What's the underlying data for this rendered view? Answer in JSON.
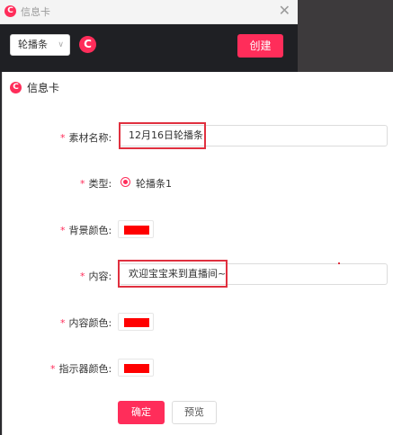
{
  "back_window": {
    "logo_glyph": "C",
    "title": "信息卡",
    "close_glyph": "✕",
    "toolbar": {
      "dropdown_value": "轮播条",
      "dropdown_chevron": "∨",
      "refresh_glyph": "C",
      "create_label": "创建"
    }
  },
  "dialog": {
    "logo_glyph": "C",
    "title": "信息卡",
    "form": {
      "material_name": {
        "label": "素材名称:",
        "value": "12月16日轮播条"
      },
      "type": {
        "label": "类型:",
        "option": "轮播条1",
        "selected": true
      },
      "bg_color": {
        "label": "背景颜色:",
        "color": "#ff0000"
      },
      "content": {
        "label": "内容:",
        "value": "欢迎宝宝来到直播间~"
      },
      "content_color": {
        "label": "内容颜色:",
        "color": "#ff0000"
      },
      "indicator_color": {
        "label": "指示器颜色:",
        "color": "#ff0000"
      },
      "required_mark": "*"
    },
    "buttons": {
      "ok_label": "确定",
      "preview_label": "预览"
    }
  },
  "colors": {
    "accent": "#ff2d5a",
    "highlight_border": "#e0303f"
  }
}
